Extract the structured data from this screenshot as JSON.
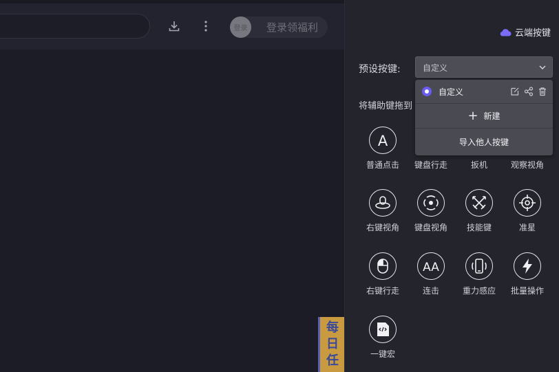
{
  "topbar": {
    "login_avatar_text": "登录",
    "login_text": "登录领福利"
  },
  "promo": {
    "chars": [
      "每",
      "日",
      "任"
    ]
  },
  "panel": {
    "cloud_label": "云端按键",
    "preset_label": "预设按键:",
    "preset_value": "自定义",
    "drag_hint": "将辅助键拖到"
  },
  "dropdown": {
    "current": "自定义",
    "new_label": "新建",
    "import_label": "导入他人按键"
  },
  "tools": [
    {
      "label": "普通点击",
      "icon": "letter-a-icon"
    },
    {
      "label": "键盘行走",
      "icon": "keyboard-walk-icon"
    },
    {
      "label": "扳机",
      "icon": "trigger-icon"
    },
    {
      "label": "观察视角",
      "icon": "observe-view-icon"
    },
    {
      "label": "右键视角",
      "icon": "right-click-view-icon"
    },
    {
      "label": "键盘视角",
      "icon": "keyboard-view-icon"
    },
    {
      "label": "技能键",
      "icon": "crossed-swords-icon"
    },
    {
      "label": "准星",
      "icon": "crosshair-icon"
    },
    {
      "label": "右键行走",
      "icon": "mouse-icon"
    },
    {
      "label": "连击",
      "icon": "double-a-icon"
    },
    {
      "label": "重力感应",
      "icon": "phone-gravity-icon"
    },
    {
      "label": "批量操作",
      "icon": "lightning-icon"
    },
    {
      "label": "一键宏",
      "icon": "code-file-icon"
    }
  ],
  "colors": {
    "accent": "#6a5cf0",
    "panel_bg": "#24242c",
    "app_bg": "#1c1c26"
  }
}
